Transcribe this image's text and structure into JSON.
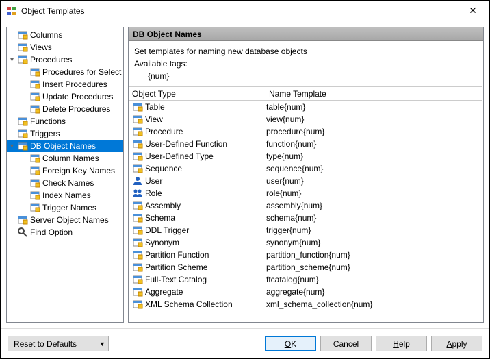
{
  "window": {
    "title": "Object Templates"
  },
  "tree": [
    {
      "label": "Columns",
      "level": 0,
      "icon": "columns",
      "exp": ""
    },
    {
      "label": "Views",
      "level": 0,
      "icon": "view",
      "exp": ""
    },
    {
      "label": "Procedures",
      "level": 0,
      "icon": "proc",
      "exp": "-"
    },
    {
      "label": "Procedures for Select",
      "level": 1,
      "icon": "proc",
      "exp": ""
    },
    {
      "label": "Insert Procedures",
      "level": 1,
      "icon": "proc",
      "exp": ""
    },
    {
      "label": "Update Procedures",
      "level": 1,
      "icon": "proc",
      "exp": ""
    },
    {
      "label": "Delete Procedures",
      "level": 1,
      "icon": "proc",
      "exp": ""
    },
    {
      "label": "Functions",
      "level": 0,
      "icon": "func",
      "exp": ""
    },
    {
      "label": "Triggers",
      "level": 0,
      "icon": "trig",
      "exp": ""
    },
    {
      "label": "DB Object Names",
      "level": 0,
      "icon": "db",
      "exp": "-",
      "selected": true
    },
    {
      "label": "Column Names",
      "level": 1,
      "icon": "columns",
      "exp": ""
    },
    {
      "label": "Foreign Key Names",
      "level": 1,
      "icon": "fk",
      "exp": ""
    },
    {
      "label": "Check Names",
      "level": 1,
      "icon": "check",
      "exp": ""
    },
    {
      "label": "Index Names",
      "level": 1,
      "icon": "index",
      "exp": ""
    },
    {
      "label": "Trigger Names",
      "level": 1,
      "icon": "trig",
      "exp": ""
    },
    {
      "label": "Server Object Names",
      "level": 0,
      "icon": "server",
      "exp": ""
    },
    {
      "label": "Find Option",
      "level": 0,
      "icon": "find",
      "exp": ""
    }
  ],
  "panel": {
    "header": "DB Object Names",
    "desc": "Set templates for naming new database objects",
    "avail": "Available tags:",
    "tag": "{num}",
    "colA": "Object Type",
    "colB": "Name Template"
  },
  "rows": [
    {
      "type": "Table",
      "tpl": "table{num}",
      "icon": "table"
    },
    {
      "type": "View",
      "tpl": "view{num}",
      "icon": "view"
    },
    {
      "type": "Procedure",
      "tpl": "procedure{num}",
      "icon": "proc"
    },
    {
      "type": "User-Defined Function",
      "tpl": "function{num}",
      "icon": "func"
    },
    {
      "type": "User-Defined Type",
      "tpl": "type{num}",
      "icon": "type"
    },
    {
      "type": "Sequence",
      "tpl": "sequence{num}",
      "icon": "seq"
    },
    {
      "type": "User",
      "tpl": "user{num}",
      "icon": "user"
    },
    {
      "type": "Role",
      "tpl": "role{num}",
      "icon": "role"
    },
    {
      "type": "Assembly",
      "tpl": "assembly{num}",
      "icon": "asm"
    },
    {
      "type": "Schema",
      "tpl": "schema{num}",
      "icon": "schema"
    },
    {
      "type": "DDL Trigger",
      "tpl": "trigger{num}",
      "icon": "trig"
    },
    {
      "type": "Synonym",
      "tpl": "synonym{num}",
      "icon": "syn"
    },
    {
      "type": "Partition Function",
      "tpl": "partition_function{num}",
      "icon": "pfunc"
    },
    {
      "type": "Partition Scheme",
      "tpl": "partition_scheme{num}",
      "icon": "psch"
    },
    {
      "type": "Full-Text Catalog",
      "tpl": "ftcatalog{num}",
      "icon": "ft"
    },
    {
      "type": "Aggregate",
      "tpl": "aggregate{num}",
      "icon": "agg"
    },
    {
      "type": "XML Schema Collection",
      "tpl": "xml_schema_collection{num}",
      "icon": "xml"
    }
  ],
  "buttons": {
    "reset": "Reset to Defaults",
    "ok": "OK",
    "cancel": "Cancel",
    "help": "Help",
    "apply": "Apply"
  }
}
